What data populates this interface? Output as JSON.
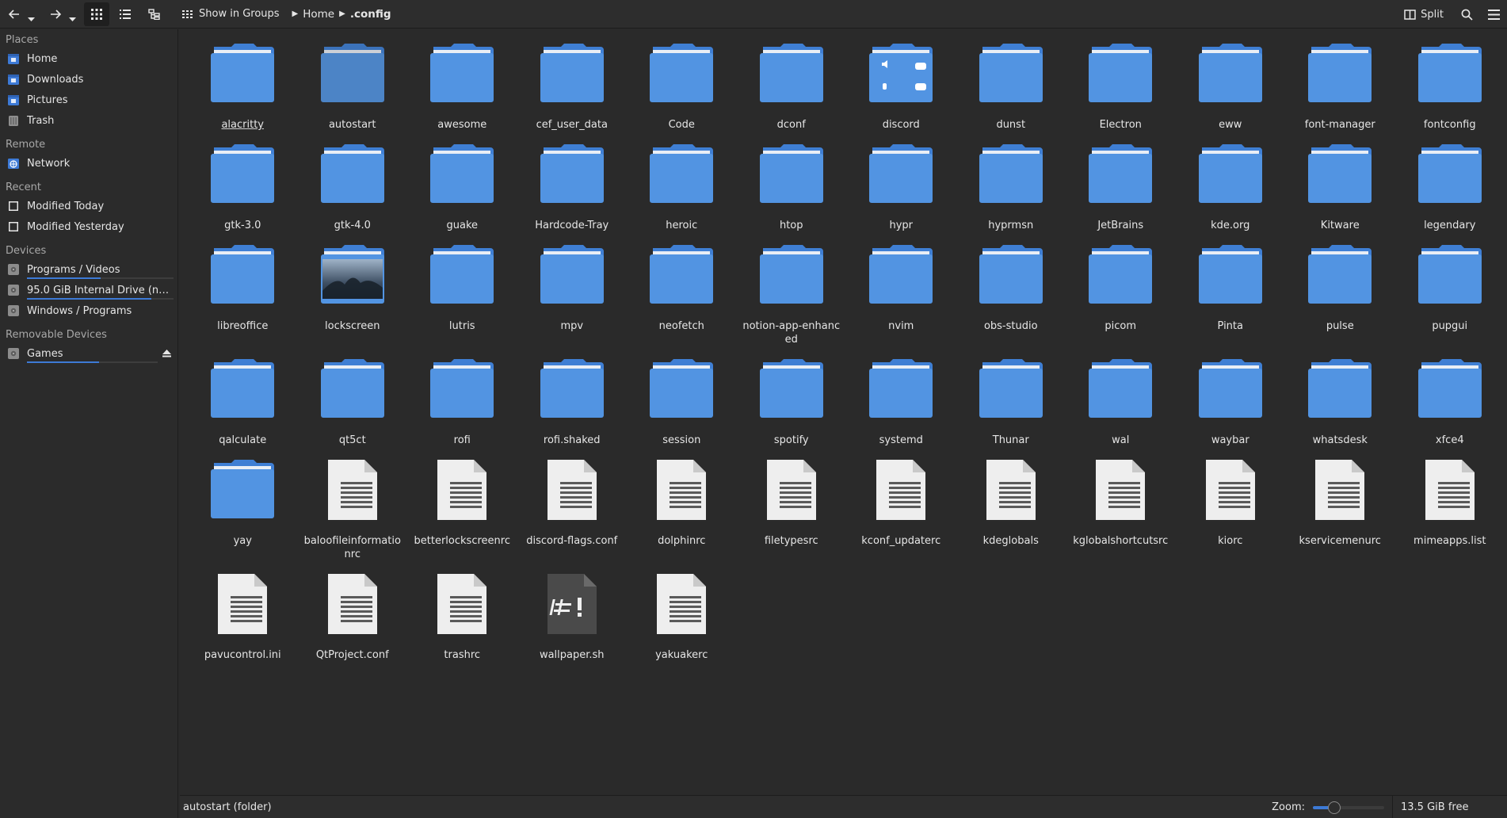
{
  "toolbar": {
    "view_label": "Show in Groups",
    "split_label": "Split",
    "breadcrumb": [
      "Home",
      ".config"
    ]
  },
  "sidebar": {
    "sections": [
      {
        "title": "Places",
        "items": [
          {
            "label": "Home",
            "icon": "home-folder-icon"
          },
          {
            "label": "Downloads",
            "icon": "downloads-folder-icon"
          },
          {
            "label": "Pictures",
            "icon": "pictures-folder-icon"
          },
          {
            "label": "Trash",
            "icon": "trash-icon"
          }
        ]
      },
      {
        "title": "Remote",
        "items": [
          {
            "label": "Network",
            "icon": "network-icon"
          }
        ]
      },
      {
        "title": "Recent",
        "items": [
          {
            "label": "Modified Today",
            "icon": "calendar-icon"
          },
          {
            "label": "Modified Yesterday",
            "icon": "calendar-icon"
          }
        ]
      },
      {
        "title": "Devices",
        "items": [
          {
            "label": "Programs / Videos",
            "icon": "drive-icon",
            "usage": 0.5
          },
          {
            "label": "95.0 GiB Internal Drive (nvme0n1p5)",
            "icon": "drive-icon",
            "usage": 0.85
          },
          {
            "label": "Windows / Programs",
            "icon": "drive-icon"
          }
        ]
      },
      {
        "title": "Removable Devices",
        "items": [
          {
            "label": "Games",
            "icon": "drive-icon",
            "usage": 0.55,
            "eject": true
          }
        ]
      }
    ]
  },
  "files": [
    {
      "name": "alacritty",
      "type": "folder",
      "selected": true
    },
    {
      "name": "autostart",
      "type": "folder",
      "hover": true
    },
    {
      "name": "awesome",
      "type": "folder"
    },
    {
      "name": "cef_user_data",
      "type": "folder"
    },
    {
      "name": "Code",
      "type": "folder"
    },
    {
      "name": "dconf",
      "type": "folder"
    },
    {
      "name": "discord",
      "type": "folder-preview"
    },
    {
      "name": "dunst",
      "type": "folder"
    },
    {
      "name": "Electron",
      "type": "folder"
    },
    {
      "name": "eww",
      "type": "folder"
    },
    {
      "name": "font-manager",
      "type": "folder"
    },
    {
      "name": "fontconfig",
      "type": "folder"
    },
    {
      "name": "gtk-3.0",
      "type": "folder"
    },
    {
      "name": "gtk-4.0",
      "type": "folder"
    },
    {
      "name": "guake",
      "type": "folder"
    },
    {
      "name": "Hardcode-Tray",
      "type": "folder"
    },
    {
      "name": "heroic",
      "type": "folder"
    },
    {
      "name": "htop",
      "type": "folder"
    },
    {
      "name": "hypr",
      "type": "folder"
    },
    {
      "name": "hyprmsn",
      "type": "folder"
    },
    {
      "name": "JetBrains",
      "type": "folder"
    },
    {
      "name": "kde.org",
      "type": "folder"
    },
    {
      "name": "Kitware",
      "type": "folder"
    },
    {
      "name": "legendary",
      "type": "folder"
    },
    {
      "name": "libreoffice",
      "type": "folder"
    },
    {
      "name": "lockscreen",
      "type": "folder-image"
    },
    {
      "name": "lutris",
      "type": "folder"
    },
    {
      "name": "mpv",
      "type": "folder"
    },
    {
      "name": "neofetch",
      "type": "folder"
    },
    {
      "name": "notion-app-enhanced",
      "type": "folder"
    },
    {
      "name": "nvim",
      "type": "folder"
    },
    {
      "name": "obs-studio",
      "type": "folder"
    },
    {
      "name": "picom",
      "type": "folder"
    },
    {
      "name": "Pinta",
      "type": "folder"
    },
    {
      "name": "pulse",
      "type": "folder"
    },
    {
      "name": "pupgui",
      "type": "folder"
    },
    {
      "name": "qalculate",
      "type": "folder"
    },
    {
      "name": "qt5ct",
      "type": "folder"
    },
    {
      "name": "rofi",
      "type": "folder"
    },
    {
      "name": "rofi.shaked",
      "type": "folder"
    },
    {
      "name": "session",
      "type": "folder"
    },
    {
      "name": "spotify",
      "type": "folder"
    },
    {
      "name": "systemd",
      "type": "folder"
    },
    {
      "name": "Thunar",
      "type": "folder"
    },
    {
      "name": "wal",
      "type": "folder"
    },
    {
      "name": "waybar",
      "type": "folder"
    },
    {
      "name": "whatsdesk",
      "type": "folder"
    },
    {
      "name": "xfce4",
      "type": "folder"
    },
    {
      "name": "yay",
      "type": "folder"
    },
    {
      "name": "baloofileinformationrc",
      "type": "text"
    },
    {
      "name": "betterlockscreenrc",
      "type": "text"
    },
    {
      "name": "discord-flags.conf",
      "type": "text"
    },
    {
      "name": "dolphinrc",
      "type": "text"
    },
    {
      "name": "filetypesrc",
      "type": "text"
    },
    {
      "name": "kconf_updaterc",
      "type": "text"
    },
    {
      "name": "kdeglobals",
      "type": "text"
    },
    {
      "name": "kglobalshortcutsrc",
      "type": "text"
    },
    {
      "name": "kiorc",
      "type": "text"
    },
    {
      "name": "kservicemenurc",
      "type": "text"
    },
    {
      "name": "mimeapps.list",
      "type": "text"
    },
    {
      "name": "pavucontrol.ini",
      "type": "text"
    },
    {
      "name": "QtProject.conf",
      "type": "text"
    },
    {
      "name": "trashrc",
      "type": "text"
    },
    {
      "name": "wallpaper.sh",
      "type": "script"
    },
    {
      "name": "yakuakerc",
      "type": "text"
    }
  ],
  "statusbar": {
    "text": "autostart (folder)",
    "zoom_label": "Zoom:",
    "zoom_level": 0.3,
    "free_space": "13.5 GiB free"
  },
  "colors": {
    "folder": "#5294e2",
    "folder_tab": "#3f7fd4",
    "accent": "#3d7ad6"
  }
}
